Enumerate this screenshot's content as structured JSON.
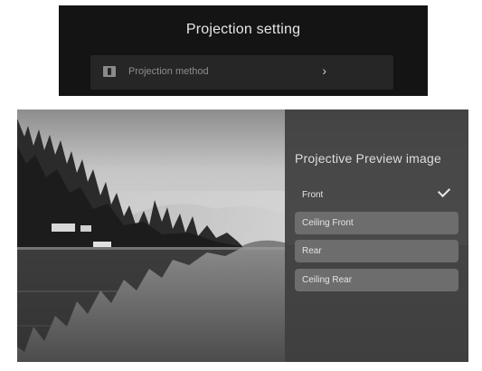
{
  "projection_setting": {
    "title": "Projection setting",
    "menu_item": {
      "icon": "projection-icon",
      "label": "Projection method",
      "chevron": "›"
    }
  },
  "preview_menu": {
    "title": "Projective Preview image",
    "options": [
      {
        "label": "Front",
        "selected": true,
        "icon": "check-icon"
      },
      {
        "label": "Ceiling Front",
        "selected": false
      },
      {
        "label": "Rear",
        "selected": false
      },
      {
        "label": "Ceiling Rear",
        "selected": false
      }
    ]
  }
}
